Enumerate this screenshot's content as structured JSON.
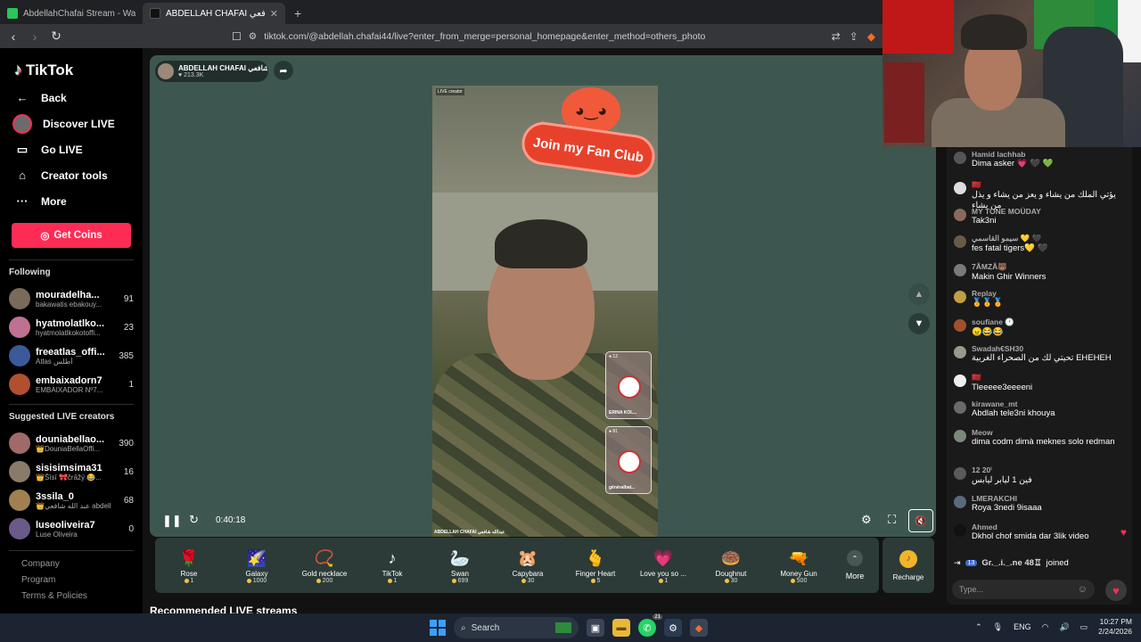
{
  "browser": {
    "tabs": [
      {
        "title": "AbdellahChafai Stream - Watch Live",
        "favicon_color": "#29c45a",
        "active": false
      },
      {
        "title": "ABDELLAH CHAFAI عبدالله شافعي",
        "favicon_color": "#000000",
        "active": true
      }
    ],
    "url": "tiktok.com/@abdellah.chafai44/live?enter_from_merge=personal_homepage&enter_method=others_photo"
  },
  "sidebar": {
    "logo": "TikTok",
    "nav": [
      {
        "label": "Back",
        "icon": "arrow-left-icon"
      },
      {
        "label": "Discover LIVE",
        "icon": "avatar-icon"
      },
      {
        "label": "Go LIVE",
        "icon": "camera-icon"
      },
      {
        "label": "Creator tools",
        "icon": "house-icon"
      },
      {
        "label": "More",
        "icon": "ellipsis-icon"
      }
    ],
    "get_coins": "Get Coins",
    "following_title": "Following",
    "following": [
      {
        "name": "mouradelha...",
        "sub": "bakawatis ebakouy...",
        "count": "91",
        "color": "#7a6a5a"
      },
      {
        "name": "hyatmolatlko...",
        "sub": "hyatmolatlkokotoffi...",
        "count": "23",
        "color": "#c07090"
      },
      {
        "name": "freeatlas_offi...",
        "sub": "Atlas أطلس",
        "count": "385",
        "color": "#3a5a9a"
      },
      {
        "name": "embaixadorn7",
        "sub": "EMBAIXADOR Nº7...",
        "count": "1",
        "color": "#b05030"
      }
    ],
    "suggested_title": "Suggested LIVE creators",
    "suggested": [
      {
        "name": "douniabellao...",
        "sub": "👑DouniaBellaOffi...",
        "count": "390",
        "color": "#a06a6a"
      },
      {
        "name": "sisisimsima31",
        "sub": "👑Šīsī 🎀črāžý 😂...",
        "count": "16",
        "color": "#8a7a6a"
      },
      {
        "name": "3ssila_0",
        "sub": "👑عبد الله شافعي abdellah...",
        "count": "68",
        "color": "#a08050"
      },
      {
        "name": "luseoliveira7",
        "sub": "Luse Oliveira",
        "count": "0",
        "color": "#6a5a8a"
      }
    ],
    "footer": [
      "Company",
      "Program",
      "Terms & Policies"
    ]
  },
  "player": {
    "host_name": "ABDELLAH CHAFAI عبدالله شافعي",
    "host_likes": "213.3K",
    "live_creator_tag": "LIVE creator",
    "fan_club": "Join my Fan Club",
    "guest1_count": "12",
    "guest1_name": "ERINA KOL...",
    "guest2_count": "81",
    "guest2_name": "gênéralbat...",
    "video_bottom_name": "ABDELLAH CHAFAI عبدالله شافعي",
    "elapsed": "0:40:18"
  },
  "gifts": [
    {
      "name": "Rose",
      "price": "1",
      "icon": "🌹"
    },
    {
      "name": "Galaxy",
      "price": "1000",
      "icon": "🌠"
    },
    {
      "name": "Gold necklace",
      "price": "200",
      "icon": "📿"
    },
    {
      "name": "TikTok",
      "price": "1",
      "icon": "♪"
    },
    {
      "name": "Swan",
      "price": "699",
      "icon": "🦢"
    },
    {
      "name": "Capybara",
      "price": "30",
      "icon": "🐹"
    },
    {
      "name": "Finger Heart",
      "price": "5",
      "icon": "🫰"
    },
    {
      "name": "Love you so ...",
      "price": "1",
      "icon": "💗"
    },
    {
      "name": "Doughnut",
      "price": "30",
      "icon": "🍩"
    },
    {
      "name": "Money Gun",
      "price": "500",
      "icon": "🔫"
    }
  ],
  "more_label": "More",
  "recharge_label": "Recharge",
  "recommended_title": "Recommended LIVE streams",
  "chat": {
    "messages": [
      {
        "user": "Hamid lachhab",
        "text": "Dima asker 💗 🖤 💚",
        "color": "#555"
      },
      {
        "user": "🇲🇦",
        "text": "يؤتي الملك من يشاء و يعز من يشاء و يذل من يشاء",
        "color": "#ddd"
      },
      {
        "user": "MY TONE MOÜDAY",
        "text": "Tak3ni",
        "color": "#8a6a5a"
      },
      {
        "user": "سيمو القاسمي 💛 🖤",
        "text": "fes fatal tigers💛 🖤",
        "color": "#6a5a4a"
      },
      {
        "user": "7ÂMZÂ🐻",
        "text": "Makin Ghir Winners",
        "color": "#7a7a7a"
      },
      {
        "user": "Replay",
        "text": "🏅🏅🏅",
        "color": "#c0a040"
      },
      {
        "user": "soufiane 🕐",
        "text": "😠😂😂",
        "color": "#a05030"
      },
      {
        "user": "Swadah€SH30",
        "text": "تحيتي لك من الصحراء الغربية EHEHEH",
        "color": "#9a9a8a"
      },
      {
        "user": "🇲🇦",
        "text": "Tleeeee3eeeeni",
        "color": "#eee"
      },
      {
        "user": "kirawane_mt",
        "text": "Abdlah tele3ni khouya",
        "color": "#6a6a6a"
      },
      {
        "user": "Meow",
        "text": "dima codm dimà meknes solo redman",
        "color": "#7a8a7a"
      },
      {
        "user": "12 20ⁱ",
        "text": "فين 1 ليابر ليابس",
        "color": "#5a5a5a"
      },
      {
        "user": "LMERAKCHI",
        "text": "Roya 3nedi 9isaaa",
        "color": "#5a6a7a"
      },
      {
        "user": "Ahmed",
        "text": "Dkhol chof smida dar 3lik video",
        "color": "#111"
      }
    ],
    "joined_level": "13",
    "joined_user": "Gr._.i._.ne 48♖",
    "joined_text": "joined",
    "input_placeholder": "Type..."
  },
  "taskbar": {
    "search": "Search",
    "notif_badge": "21",
    "lang": "ENG",
    "time": "10:27 PM",
    "date": "2/24/2026"
  }
}
